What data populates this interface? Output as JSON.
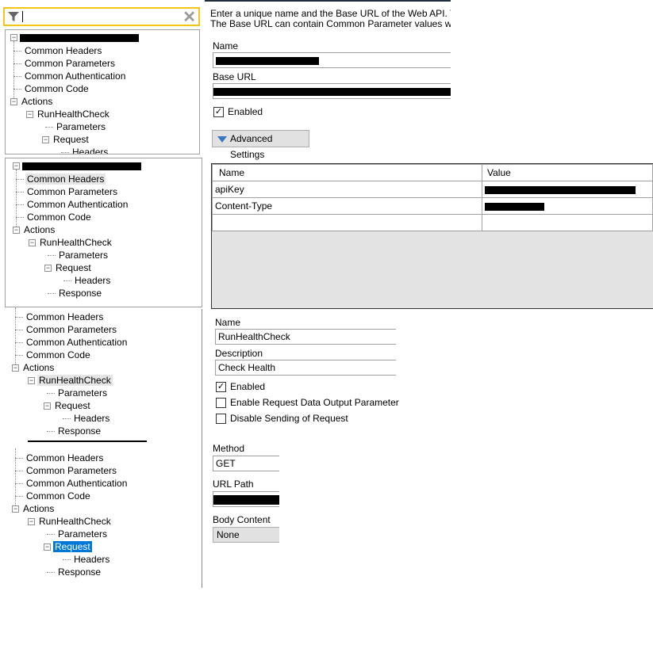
{
  "filter": {
    "value": "",
    "icon": "filter-icon",
    "clear_icon": "close-icon"
  },
  "trees": [
    {
      "items": [
        {
          "label": "Common Headers",
          "level": 1
        },
        {
          "label": "Common Parameters",
          "level": 1
        },
        {
          "label": "Common Authentication",
          "level": 1
        },
        {
          "label": "Common Code",
          "level": 1
        },
        {
          "label": "Actions",
          "level": 1,
          "expander": true
        },
        {
          "label": "RunHealthCheck",
          "level": 2,
          "expander": true
        },
        {
          "label": "Parameters",
          "level": 3
        },
        {
          "label": "Request",
          "level": 3,
          "expander": true
        },
        {
          "label": "Headers",
          "level": 4
        }
      ]
    },
    {
      "items": [
        {
          "label": "Common Headers",
          "level": 1,
          "state": "hover"
        },
        {
          "label": "Common Parameters",
          "level": 1
        },
        {
          "label": "Common Authentication",
          "level": 1
        },
        {
          "label": "Common Code",
          "level": 1
        },
        {
          "label": "Actions",
          "level": 1,
          "expander": true
        },
        {
          "label": "RunHealthCheck",
          "level": 2,
          "expander": true
        },
        {
          "label": "Parameters",
          "level": 3
        },
        {
          "label": "Request",
          "level": 3,
          "expander": true
        },
        {
          "label": "Headers",
          "level": 4
        },
        {
          "label": "Response",
          "level": 3
        }
      ]
    },
    {
      "items": [
        {
          "label": "Common Headers",
          "level": 1
        },
        {
          "label": "Common Parameters",
          "level": 1
        },
        {
          "label": "Common Authentication",
          "level": 1
        },
        {
          "label": "Common Code",
          "level": 1
        },
        {
          "label": "Actions",
          "level": 1,
          "expander": true
        },
        {
          "label": "RunHealthCheck",
          "level": 2,
          "expander": true,
          "state": "hover"
        },
        {
          "label": "Parameters",
          "level": 3
        },
        {
          "label": "Request",
          "level": 3,
          "expander": true
        },
        {
          "label": "Headers",
          "level": 4
        },
        {
          "label": "Response",
          "level": 3
        }
      ]
    },
    {
      "items": [
        {
          "label": "Common Headers",
          "level": 1
        },
        {
          "label": "Common Parameters",
          "level": 1
        },
        {
          "label": "Common Authentication",
          "level": 1
        },
        {
          "label": "Common Code",
          "level": 1
        },
        {
          "label": "Actions",
          "level": 1,
          "expander": true
        },
        {
          "label": "RunHealthCheck",
          "level": 2,
          "expander": true
        },
        {
          "label": "Parameters",
          "level": 3
        },
        {
          "label": "Request",
          "level": 3,
          "expander": true,
          "state": "selected"
        },
        {
          "label": "Headers",
          "level": 4
        },
        {
          "label": "Response",
          "level": 3
        }
      ]
    }
  ],
  "api_form": {
    "intro_line1": "Enter a unique name and the Base URL of the Web API. The U",
    "intro_line2": "The Base URL can contain Common Parameter values whe",
    "name_label": "Name",
    "base_url_label": "Base URL",
    "enabled_label": "Enabled",
    "enabled": true,
    "advanced_label": "Advanced Settings"
  },
  "headers_grid": {
    "columns": [
      "Name",
      "Value"
    ],
    "rows": [
      {
        "name": "apiKey"
      },
      {
        "name": "Content-Type"
      },
      {
        "name": ""
      }
    ]
  },
  "action_form": {
    "name_label": "Name",
    "name_value": "RunHealthCheck",
    "description_label": "Description",
    "description_value": "Check Health",
    "enabled_label": "Enabled",
    "enable_output_label": "Enable Request Data Output Parameter",
    "disable_sending_label": "Disable Sending of Request"
  },
  "request_form": {
    "method_label": "Method",
    "method_value": "GET",
    "url_path_label": "URL Path",
    "body_label": "Body Content",
    "body_value": "None"
  }
}
